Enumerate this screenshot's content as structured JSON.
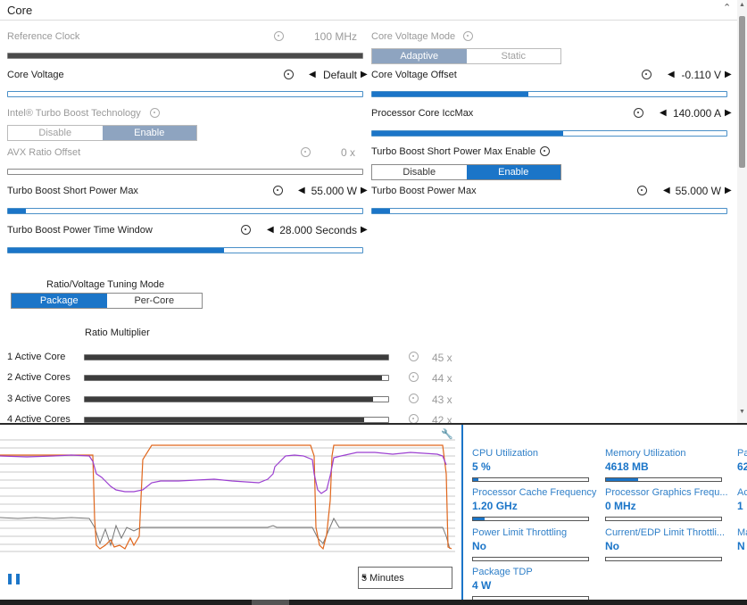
{
  "section": {
    "title": "Core"
  },
  "reference_clock": {
    "label": "Reference Clock",
    "value": "100 MHz",
    "level": 1.0
  },
  "core_voltage_mode": {
    "label": "Core Voltage Mode",
    "options": [
      "Adaptive",
      "Static"
    ],
    "selected": "Adaptive"
  },
  "core_voltage": {
    "label": "Core Voltage",
    "value": "Default",
    "level": 0.0
  },
  "core_voltage_offset": {
    "label": "Core Voltage Offset",
    "value": "-0.110 V",
    "level": 0.44
  },
  "turbo_boost_tech": {
    "label": "Intel® Turbo Boost Technology",
    "options": [
      "Disable",
      "Enable"
    ],
    "selected": "Enable"
  },
  "processor_core_iccmax": {
    "label": "Processor Core IccMax",
    "value": "140.000 A",
    "level": 0.54
  },
  "avx_ratio_offset": {
    "label": "AVX Ratio Offset",
    "value": "0 x",
    "level": 0.0
  },
  "turbo_short_enable": {
    "label": "Turbo Boost Short Power Max Enable",
    "options": [
      "Disable",
      "Enable"
    ],
    "selected": "Enable"
  },
  "turbo_short_power_max": {
    "label": "Turbo Boost Short Power Max",
    "value": "55.000 W",
    "level": 0.05
  },
  "turbo_power_max": {
    "label": "Turbo Boost Power Max",
    "value": "55.000 W",
    "level": 0.05
  },
  "turbo_time_window": {
    "label": "Turbo Boost Power Time Window",
    "value": "28.000 Seconds",
    "level": 0.61
  },
  "tuning_mode": {
    "label": "Ratio/Voltage Tuning Mode",
    "options": [
      "Package",
      "Per-Core"
    ],
    "selected": "Package"
  },
  "ratio_multiplier": {
    "label": "Ratio Multiplier",
    "rows": [
      {
        "label": "1 Active Core",
        "value": "45 x",
        "level": 1.0
      },
      {
        "label": "2 Active Cores",
        "value": "44 x",
        "level": 0.98
      },
      {
        "label": "3 Active Cores",
        "value": "43 x",
        "level": 0.95
      },
      {
        "label": "4 Active Cores",
        "value": "42 x",
        "level": 0.92
      }
    ]
  },
  "monitor": {
    "time_range": "5 Minutes",
    "series_colors": {
      "purple": "#9b3fd0",
      "orange": "#e0661c",
      "gray": "#777777"
    }
  },
  "metrics": [
    {
      "label": "CPU Utilization",
      "value": "5 %",
      "level": 0.05
    },
    {
      "label": "Memory Utilization",
      "value": "4618  MB",
      "level": 0.28
    },
    {
      "label": "Pa",
      "value": "62",
      "level": 0
    },
    {
      "label": "Processor Cache Frequency",
      "value": "1.20 GHz",
      "level": 0.1
    },
    {
      "label": "Processor Graphics Frequ...",
      "value": "0 MHz",
      "level": 0.0
    },
    {
      "label": "Ac",
      "value": "1",
      "level": 0
    },
    {
      "label": "Power Limit Throttling",
      "value": "No",
      "level": 0.0
    },
    {
      "label": "Current/EDP Limit Throttli...",
      "value": "No",
      "level": 0.0
    },
    {
      "label": "Ma",
      "value": "N",
      "level": 0
    },
    {
      "label": "Package TDP",
      "value": "4 W",
      "level": 0.0
    }
  ]
}
